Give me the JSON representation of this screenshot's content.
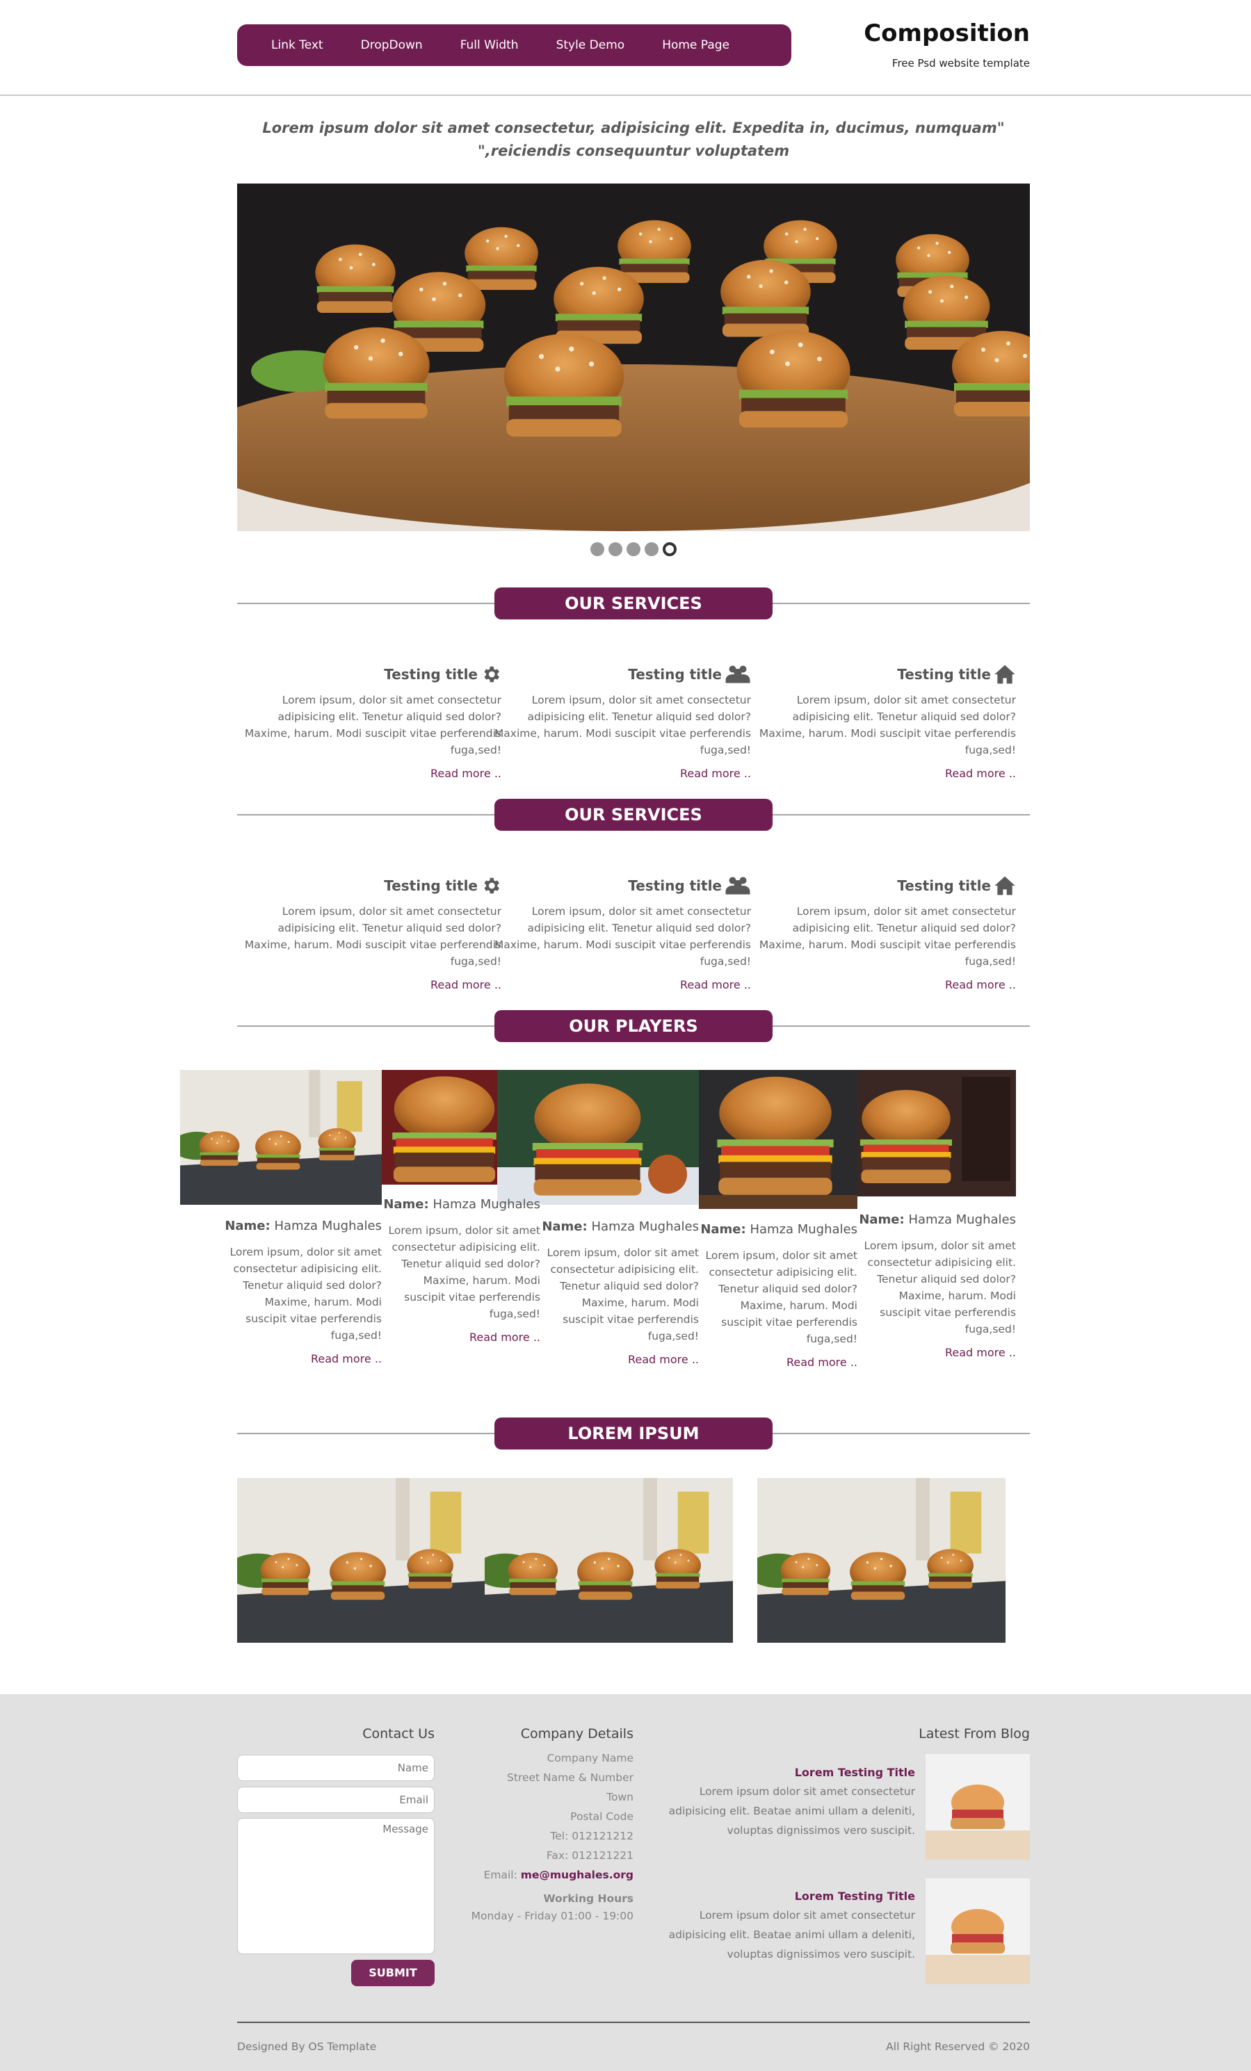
{
  "header": {
    "nav": [
      "Link Text",
      "DropDown",
      "Full Width",
      "Style Demo",
      "Home Page"
    ],
    "brand_title": "Composition",
    "brand_subtitle": "Free Psd website template"
  },
  "quote": {
    "line1": "Lorem ipsum dolor sit amet consectetur, adipisicing elit. Expedita in, ducimus, numquam\"",
    "line2": "\",reiciendis consequuntur voluptatem"
  },
  "slider": {
    "dots": 5,
    "active": 5
  },
  "sections": {
    "services1": "OUR SERVICES",
    "services2": "OUR SERVICES",
    "players": "OUR PLAYERS",
    "lorem": "LOREM IPSUM"
  },
  "services": [
    {
      "title": "Testing title",
      "icon": "gear-icon",
      "text": "Lorem ipsum, dolor sit amet consectetur adipisicing elit. Tenetur aliquid sed dolor? Maxime, harum. Modi suscipit vitae perferendis fuga,sed!",
      "read_more": "Read more .."
    },
    {
      "title": "Testing title",
      "icon": "users-icon",
      "text": "Lorem ipsum, dolor sit amet consectetur adipisicing elit. Tenetur aliquid sed dolor? Maxime, harum. Modi suscipit vitae perferendis fuga,sed!",
      "read_more": "Read more .."
    },
    {
      "title": "Testing title",
      "icon": "home-icon",
      "text": "Lorem ipsum, dolor sit amet consectetur adipisicing elit. Tenetur aliquid sed dolor? Maxime, harum. Modi suscipit vitae perferendis fuga,sed!",
      "read_more": "Read more .."
    }
  ],
  "players": [
    {
      "label": "Name:",
      "name": "Hamza Mughales",
      "text": "Lorem ipsum, dolor sit amet consectetur adipisicing elit. Tenetur aliquid sed dolor? Maxime, harum. Modi suscipit vitae perferendis fuga,sed!",
      "read_more": "Read more .."
    },
    {
      "label": "Name:",
      "name": "Hamza Mughales",
      "text": "Lorem ipsum, dolor sit amet consectetur adipisicing elit. Tenetur aliquid sed dolor? Maxime, harum. Modi suscipit vitae perferendis fuga,sed!",
      "read_more": "Read more .."
    },
    {
      "label": "Name:",
      "name": "Hamza Mughales",
      "text": "Lorem ipsum, dolor sit amet consectetur adipisicing elit. Tenetur aliquid sed dolor? Maxime, harum. Modi suscipit vitae perferendis fuga,sed!",
      "read_more": "Read more .."
    },
    {
      "label": "Name:",
      "name": "Hamza Mughales",
      "text": "Lorem ipsum, dolor sit amet consectetur adipisicing elit. Tenetur aliquid sed dolor? Maxime, harum. Modi suscipit vitae perferendis fuga,sed!",
      "read_more": "Read more .."
    },
    {
      "label": "Name:",
      "name": "Hamza Mughales",
      "text": "Lorem ipsum, dolor sit amet consectetur adipisicing elit. Tenetur aliquid sed dolor? Maxime, harum. Modi suscipit vitae perferendis fuga,sed!",
      "read_more": "Read more .."
    }
  ],
  "footer": {
    "contact_title": "Contact Us",
    "name_ph": "Name",
    "email_ph": "Email",
    "message_ph": "Message",
    "submit": "SUBMIT",
    "company_title": "Company Details",
    "company_lines": [
      "Company Name",
      "Street Name & Number",
      "Town",
      "Postal Code",
      "Tel: 012121212",
      "Fax: 012121221"
    ],
    "email_label": "Email:",
    "email_value": "me@mughales.org",
    "hours_title": "Working Hours",
    "hours": "Monday - Friday 01:00 - 19:00",
    "blog_title": "Latest From Blog",
    "blog": [
      {
        "title": "Lorem Testing Title",
        "text": "Lorem ipsum dolor sit amet consectetur adipisicing elit. Beatae animi ullam a deleniti, voluptas dignissimos vero suscipit."
      },
      {
        "title": "Lorem Testing Title",
        "text": "Lorem ipsum dolor sit amet consectetur adipisicing elit. Beatae animi ullam a deleniti, voluptas dignissimos vero suscipit."
      }
    ],
    "designed_by": "Designed By OS Template",
    "copyright": "All Right Reserved © 2020"
  },
  "colors": {
    "accent": "#701d52",
    "footer_bg": "#e1e1e1"
  }
}
